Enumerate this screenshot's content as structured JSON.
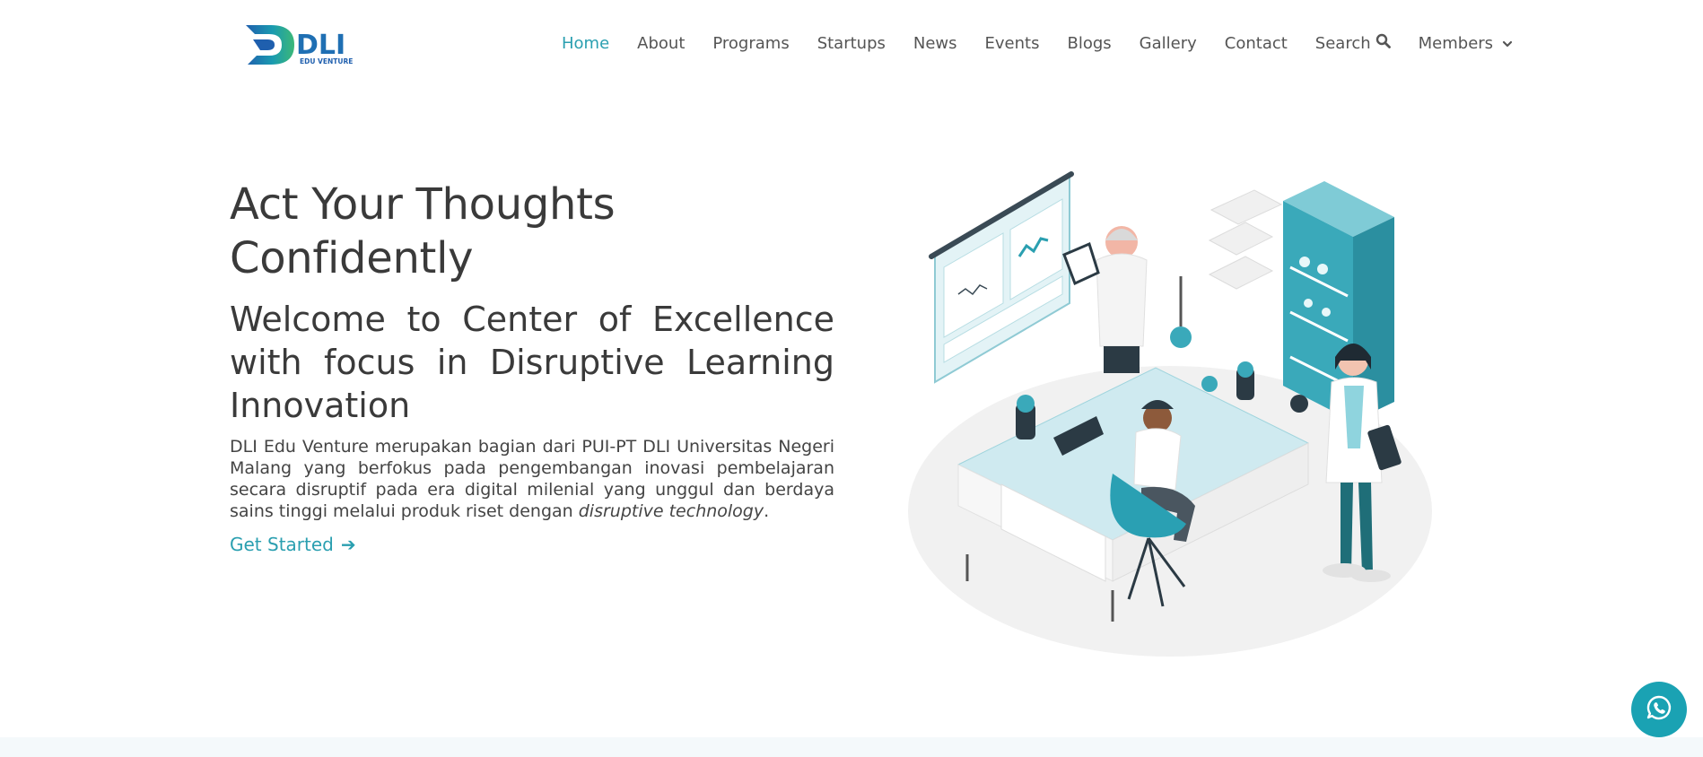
{
  "header": {
    "logo_text": "DLI",
    "logo_tagline": "EDU VENTURE",
    "nav": [
      {
        "label": "Home",
        "active": true
      },
      {
        "label": "About"
      },
      {
        "label": "Programs"
      },
      {
        "label": "Startups"
      },
      {
        "label": "News"
      },
      {
        "label": "Events"
      },
      {
        "label": "Blogs"
      },
      {
        "label": "Gallery"
      },
      {
        "label": "Contact"
      },
      {
        "label": "Search",
        "icon": "search-icon"
      },
      {
        "label": "Members",
        "icon": "chevron-down-icon"
      }
    ]
  },
  "hero": {
    "title": "Act Your Thoughts Confidently",
    "subtitle": "Welcome to Center of Excellence with focus in Disruptive Learning Innovation",
    "description": "DLI Edu Venture merupakan bagian dari PUI-PT DLI Universitas Negeri Malang yang berfokus pada pengembangan inovasi pembelajaran secara disruptif pada era digital milenial yang unggul dan berdaya sains tinggi melalui produk riset dengan",
    "description_emphasis": "disruptive technology",
    "description_end": ".",
    "cta_label": "Get Started",
    "cta_arrow": "➔"
  },
  "floating": {
    "whatsapp_icon": "whatsapp-icon"
  },
  "colors": {
    "accent": "#2a9fb0",
    "text": "#3a3a3a",
    "whatsapp": "#1aa2b3"
  }
}
